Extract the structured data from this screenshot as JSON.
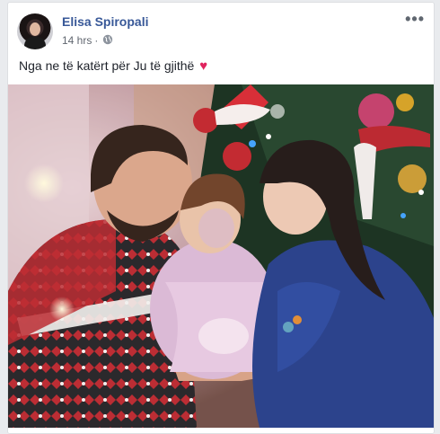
{
  "post": {
    "author": "Elisa Spiropali",
    "time": "14 hrs",
    "audience_icon": "globe-icon",
    "more_label": "•••",
    "text": "Nga ne të katërt për Ju të gjithë",
    "emoji": "♥"
  },
  "colors": {
    "author_link": "#385898",
    "meta_text": "#616770",
    "heart": "#e0245e"
  },
  "photo": {
    "description_icon": "family-christmas-photo"
  }
}
